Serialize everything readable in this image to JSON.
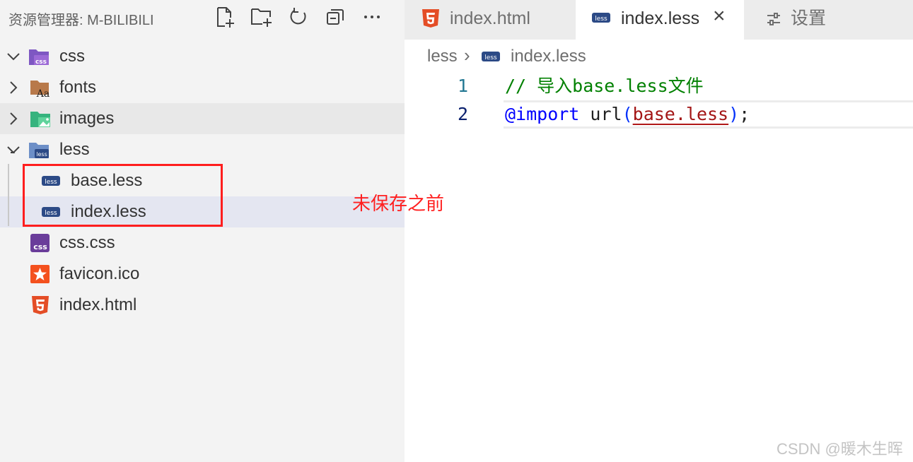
{
  "explorer": {
    "title": "资源管理器: M-BILIBILI",
    "actions": [
      {
        "name": "new-file-icon"
      },
      {
        "name": "new-folder-icon"
      },
      {
        "name": "refresh-icon"
      },
      {
        "name": "collapse-all-icon"
      },
      {
        "name": "more-icon"
      }
    ],
    "tree": [
      {
        "label": "css",
        "type": "folder",
        "expanded": true,
        "icon": "css-folder-icon"
      },
      {
        "label": "fonts",
        "type": "folder",
        "expanded": false,
        "icon": "fonts-folder-icon"
      },
      {
        "label": "images",
        "type": "folder",
        "expanded": false,
        "icon": "images-folder-icon"
      },
      {
        "label": "less",
        "type": "folder",
        "expanded": true,
        "icon": "less-folder-icon"
      },
      {
        "label": "base.less",
        "type": "file",
        "icon": "less-file-icon"
      },
      {
        "label": "index.less",
        "type": "file",
        "icon": "less-file-icon",
        "selected": true
      },
      {
        "label": "css.css",
        "type": "file",
        "icon": "css-file-icon"
      },
      {
        "label": "favicon.ico",
        "type": "file",
        "icon": "favicon-file-icon"
      },
      {
        "label": "index.html",
        "type": "file",
        "icon": "html-file-icon"
      }
    ]
  },
  "annotation": {
    "text": "未保存之前",
    "color": "#ff2020"
  },
  "tabs": [
    {
      "label": "index.html",
      "icon": "html-file-icon",
      "active": false
    },
    {
      "label": "index.less",
      "icon": "less-file-icon",
      "active": true,
      "close": "×"
    },
    {
      "label": "设置",
      "icon": "settings-icon",
      "active": false
    }
  ],
  "breadcrumb": {
    "folder": "less",
    "separator": "›",
    "file": "index.less"
  },
  "editor": {
    "lines": [
      {
        "num": "1",
        "tokens": [
          {
            "text": "// 导入base.less文件",
            "color": "#008000"
          }
        ]
      },
      {
        "num": "2",
        "tokens": [
          {
            "text": "@import",
            "color": "#0000ff"
          },
          {
            "text": " url",
            "color": "#1f1f1f"
          },
          {
            "text": "(",
            "color": "#0431fa"
          },
          {
            "text": "base.less",
            "color": "#a31515"
          },
          {
            "text": ")",
            "color": "#0431fa"
          },
          {
            "text": ";",
            "color": "#1f1f1f"
          }
        ]
      }
    ]
  },
  "watermark": "CSDN @暖木生晖",
  "colors": {
    "sidebar_bg": "#f3f3f3",
    "selection_bg": "#e4e6f1",
    "highlight_box": "#ff1e1e",
    "line_number_active": "#0b216f",
    "line_number": "#237893"
  }
}
